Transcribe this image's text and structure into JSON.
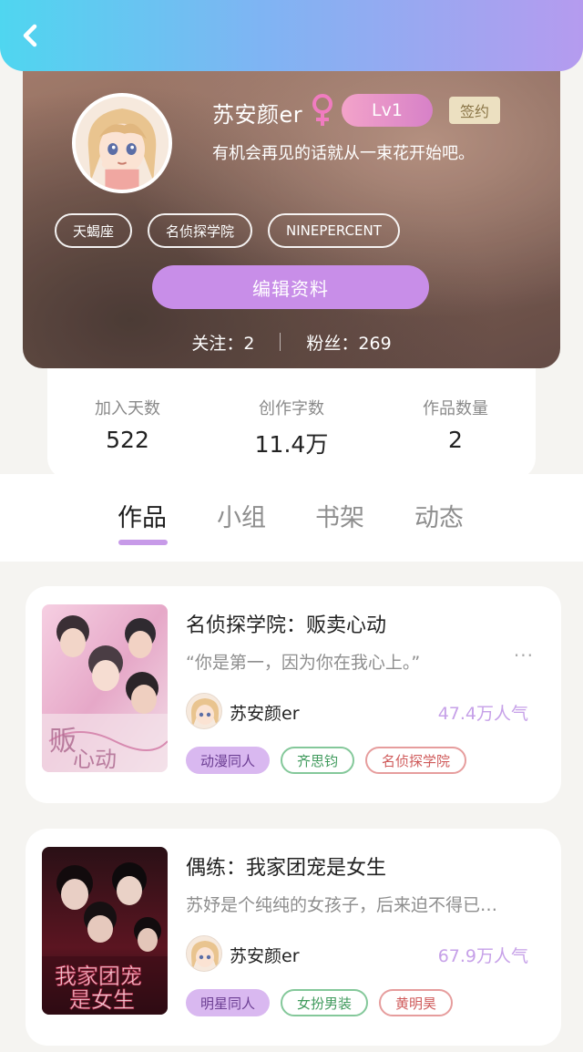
{
  "header": {
    "back_icon": "chevron-left-icon",
    "gradient": [
      "#4fd6f0",
      "#b59bef"
    ]
  },
  "profile": {
    "username": "苏安颜er",
    "gender_icon": "female-symbol-icon",
    "level": "Lv1",
    "contract_badge": "签约",
    "bio": "有机会再见的话就从一束花开始吧。",
    "tags": [
      "天蝎座",
      "名侦探学院",
      "NINEPERCENT"
    ],
    "edit_button": "编辑资料",
    "following": "关注：2",
    "followers": "粉丝：269"
  },
  "stats": [
    {
      "label": "加入天数",
      "value": "522"
    },
    {
      "label": "创作字数",
      "value": "11.4万"
    },
    {
      "label": "作品数量",
      "value": "2"
    }
  ],
  "tabs": [
    {
      "label": "作品",
      "active": true
    },
    {
      "label": "小组",
      "active": false
    },
    {
      "label": "书架",
      "active": false
    },
    {
      "label": "动态",
      "active": false
    }
  ],
  "works": [
    {
      "title": "名侦探学院：贩卖心动",
      "desc": "“你是第一，因为你在我心上。”",
      "more": "···",
      "author": "苏安颜er",
      "popularity": "47.4万人气",
      "tags": [
        {
          "label": "动漫同人",
          "style": "purple"
        },
        {
          "label": "齐思钧",
          "style": "green"
        },
        {
          "label": "名侦探学院",
          "style": "red"
        }
      ]
    },
    {
      "title": "偶练：我家团宠是女生",
      "desc": "苏妤是个纯纯的女孩子，后来迫不得已…",
      "more": "",
      "author": "苏安颜er",
      "popularity": "67.9万人气",
      "tags": [
        {
          "label": "明星同人",
          "style": "purple"
        },
        {
          "label": "女扮男装",
          "style": "green"
        },
        {
          "label": "黄明昊",
          "style": "red"
        }
      ]
    }
  ],
  "colors": {
    "accent_purple": "#c88ee8",
    "tab_indicator": "#c79ae8",
    "popularity": "#c6a0e8"
  }
}
